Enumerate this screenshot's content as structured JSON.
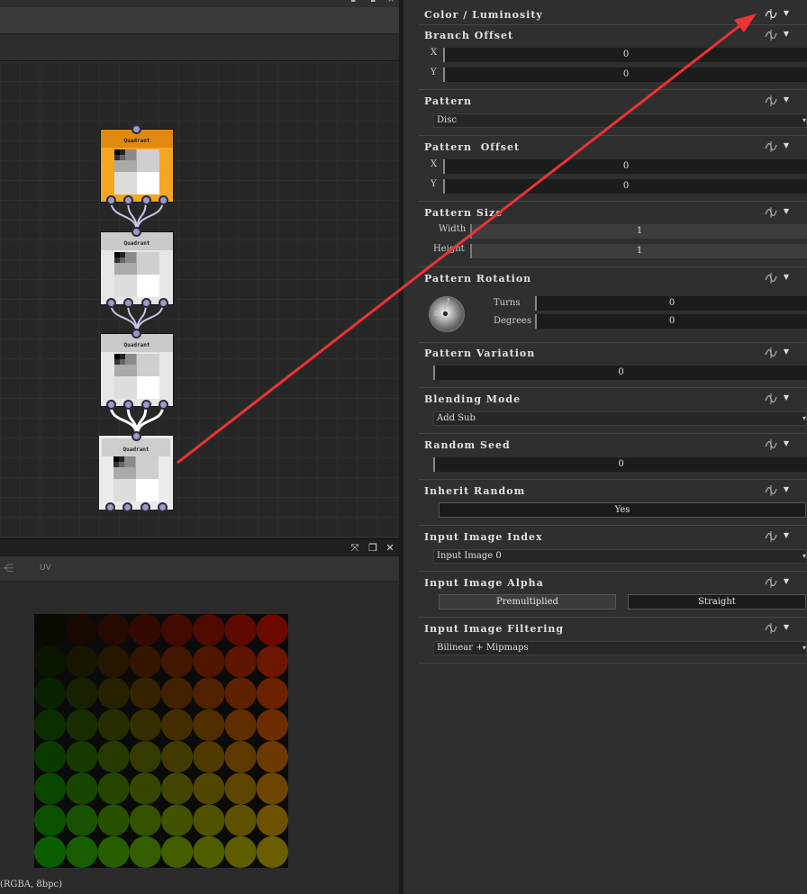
{
  "graph": {
    "nodes": [
      {
        "label": "Quadrant",
        "state": "selected"
      },
      {
        "label": "Quadrant",
        "state": "normal"
      },
      {
        "label": "Quadrant",
        "state": "normal"
      },
      {
        "label": "Quadrant",
        "state": "normal"
      }
    ]
  },
  "view": {
    "toolbar": {
      "uv_label": "UV"
    },
    "status": "(RGBA, 8bpc)",
    "grid_rows": 8,
    "grid_cols": 8
  },
  "props": {
    "color_luminosity": {
      "title": "Color / Luminosity"
    },
    "branch_offset": {
      "title": "Branch Offset",
      "x_label": "X",
      "x_value": "0",
      "y_label": "Y",
      "y_value": "0"
    },
    "pattern": {
      "title": "Pattern",
      "value": "Disc"
    },
    "pattern_offset": {
      "title": "Pattern  Offset",
      "x_label": "X",
      "x_value": "0",
      "y_label": "Y",
      "y_value": "0"
    },
    "pattern_size": {
      "title": "Pattern Size",
      "width_label": "Width",
      "width_value": "1",
      "height_label": "Height",
      "height_value": "1"
    },
    "pattern_rotation": {
      "title": "Pattern Rotation",
      "dial_label": "0",
      "turns_label": "Turns",
      "turns_value": "0",
      "degrees_label": "Degrees",
      "degrees_value": "0"
    },
    "pattern_variation": {
      "title": "Pattern Variation",
      "value": "0"
    },
    "blending_mode": {
      "title": "Blending Mode",
      "value": "Add Sub"
    },
    "random_seed": {
      "title": "Random Seed",
      "value": "0"
    },
    "inherit_random": {
      "title": "Inherit Random",
      "value": "Yes"
    },
    "input_image_index": {
      "title": "Input Image Index",
      "value": "Input Image 0"
    },
    "input_image_alpha": {
      "title": "Input Image Alpha",
      "option_a": "Premultiplied",
      "option_b": "Straight",
      "selected": "Straight"
    },
    "input_image_filtering": {
      "title": "Input Image Filtering",
      "value": "Bilinear + Mipmaps"
    }
  },
  "colors": {
    "annotation_arrow": "#ee3333",
    "node_selected": "#f5a623",
    "port": "#9a9ac8"
  }
}
